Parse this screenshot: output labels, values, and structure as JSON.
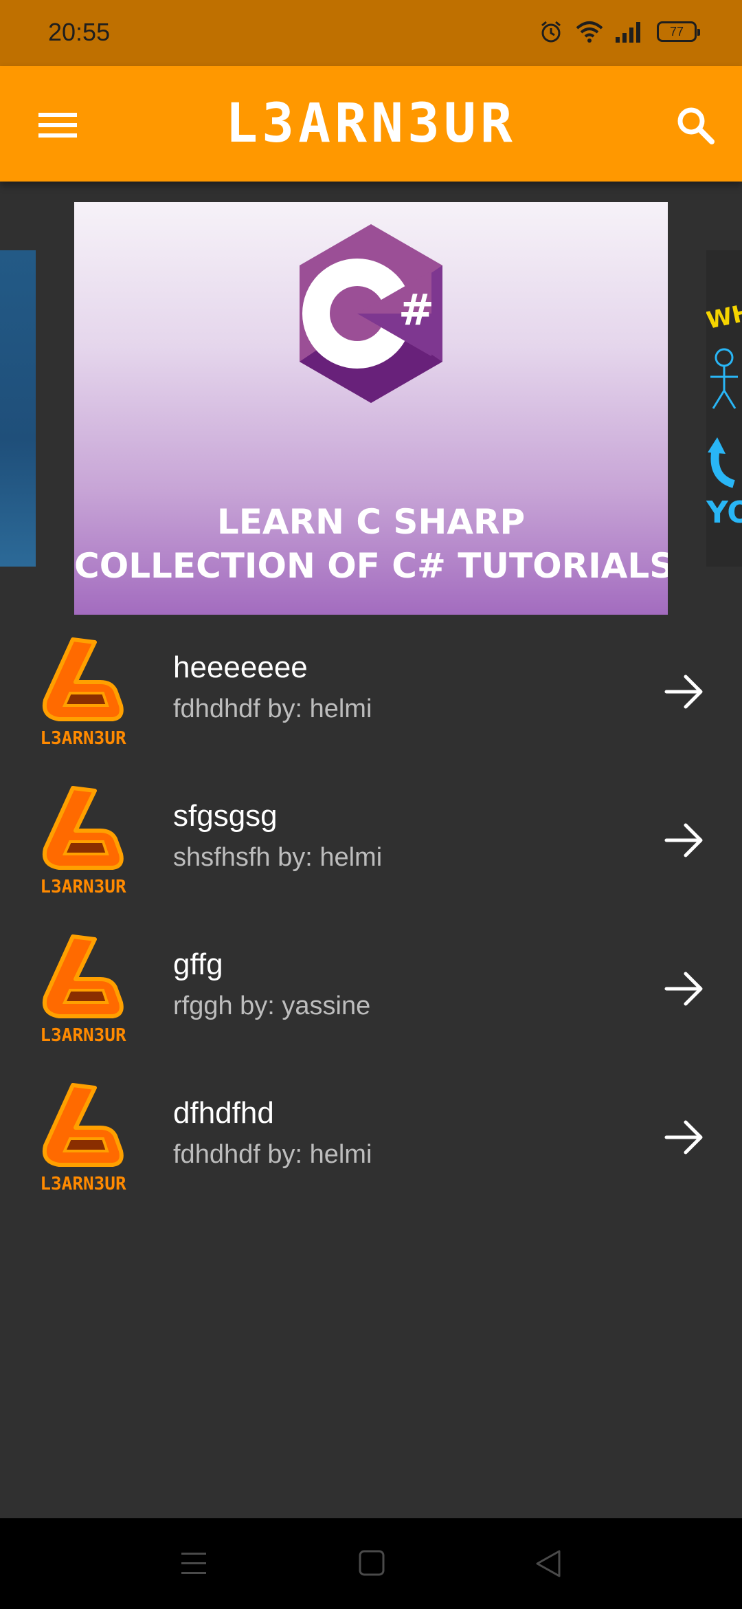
{
  "status_bar": {
    "time": "20:55",
    "battery": "77",
    "icons": [
      "alarm-icon",
      "wifi-icon",
      "signal-icon",
      "battery-icon"
    ]
  },
  "app_bar": {
    "title": "L3ARN3UR",
    "menu_icon": "menu-icon",
    "search_icon": "search-icon",
    "color": "#FF9800"
  },
  "carousel": {
    "banner_line_1": "LEARN C SHARP",
    "banner_line_2": "COLLECTION OF C# TUTORIALS",
    "logo_glyph": "C#",
    "right_peek_top": "WHY",
    "right_peek_bottom": "YO"
  },
  "items": [
    {
      "title": "heeeeeee",
      "subtitle": "fdhdhdf by: helmi",
      "logo_text": "L3ARN3UR"
    },
    {
      "title": "sfgsgsg",
      "subtitle": "shsfhsfh by: helmi",
      "logo_text": "L3ARN3UR"
    },
    {
      "title": "gffg",
      "subtitle": "rfggh by: yassine",
      "logo_text": "L3ARN3UR"
    },
    {
      "title": "dfhdfhd",
      "subtitle": "fdhdhdf by: helmi",
      "logo_text": "L3ARN3UR"
    }
  ],
  "nav_bar": {
    "buttons": [
      "recent-apps-icon",
      "home-icon",
      "back-icon"
    ]
  },
  "colors": {
    "status_bar": "#BF7000",
    "background": "#303030",
    "accent": "#FF9800",
    "logo_orange": "#FF6A00"
  }
}
